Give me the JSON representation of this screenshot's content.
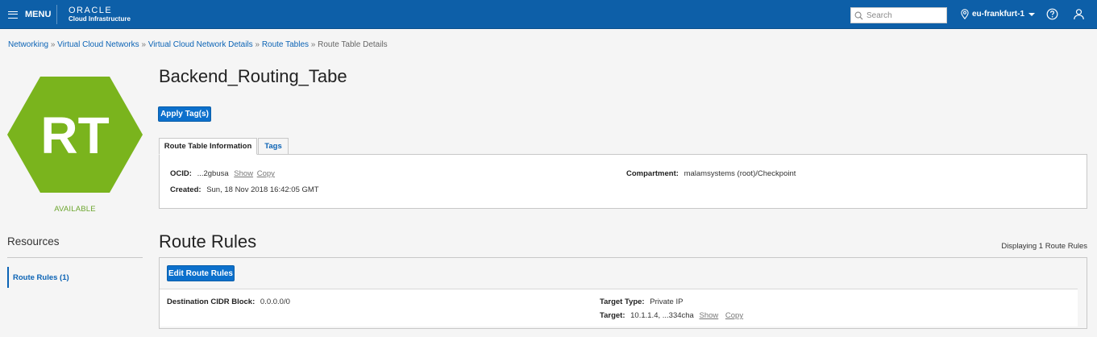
{
  "topbar": {
    "menu_label": "MENU",
    "brand_line1": "ORACLE",
    "brand_line2": "Cloud Infrastructure",
    "search_placeholder": "Search",
    "region": "eu-frankfurt-1"
  },
  "breadcrumb": [
    "Networking",
    "Virtual Cloud Networks",
    "Virtual Cloud Network Details",
    "Route Tables",
    "Route Table Details"
  ],
  "breadcrumb_separator": "»",
  "resource": {
    "badge_text": "RT",
    "badge_color": "#7ab41d",
    "status": "AVAILABLE",
    "title": "Backend_Routing_Tabe",
    "apply_tags_label": "Apply Tag(s)"
  },
  "tabs": {
    "info": "Route Table Information",
    "tags": "Tags"
  },
  "info": {
    "ocid_label": "OCID:",
    "ocid_value": "...2gbusa",
    "show": "Show",
    "copy": "Copy",
    "created_label": "Created:",
    "created_value": "Sun, 18 Nov 2018 16:42:05 GMT",
    "compartment_label": "Compartment:",
    "compartment_value": "malamsystems (root)/Checkpoint"
  },
  "resources": {
    "title": "Resources",
    "item": "Route Rules (1)"
  },
  "route_rules": {
    "title": "Route Rules",
    "count_text": "Displaying 1 Route Rules",
    "edit_label": "Edit Route Rules",
    "rule": {
      "dest_label": "Destination CIDR Block:",
      "dest_value": "0.0.0.0/0",
      "type_label": "Target Type:",
      "type_value": "Private IP",
      "target_label": "Target:",
      "target_value": "10.1.1.4, ...334cha",
      "show": "Show",
      "copy": "Copy"
    }
  },
  "colors": {
    "topbar": "#0d5fa8",
    "accent": "#0c70cc",
    "available": "#6ca62e"
  }
}
